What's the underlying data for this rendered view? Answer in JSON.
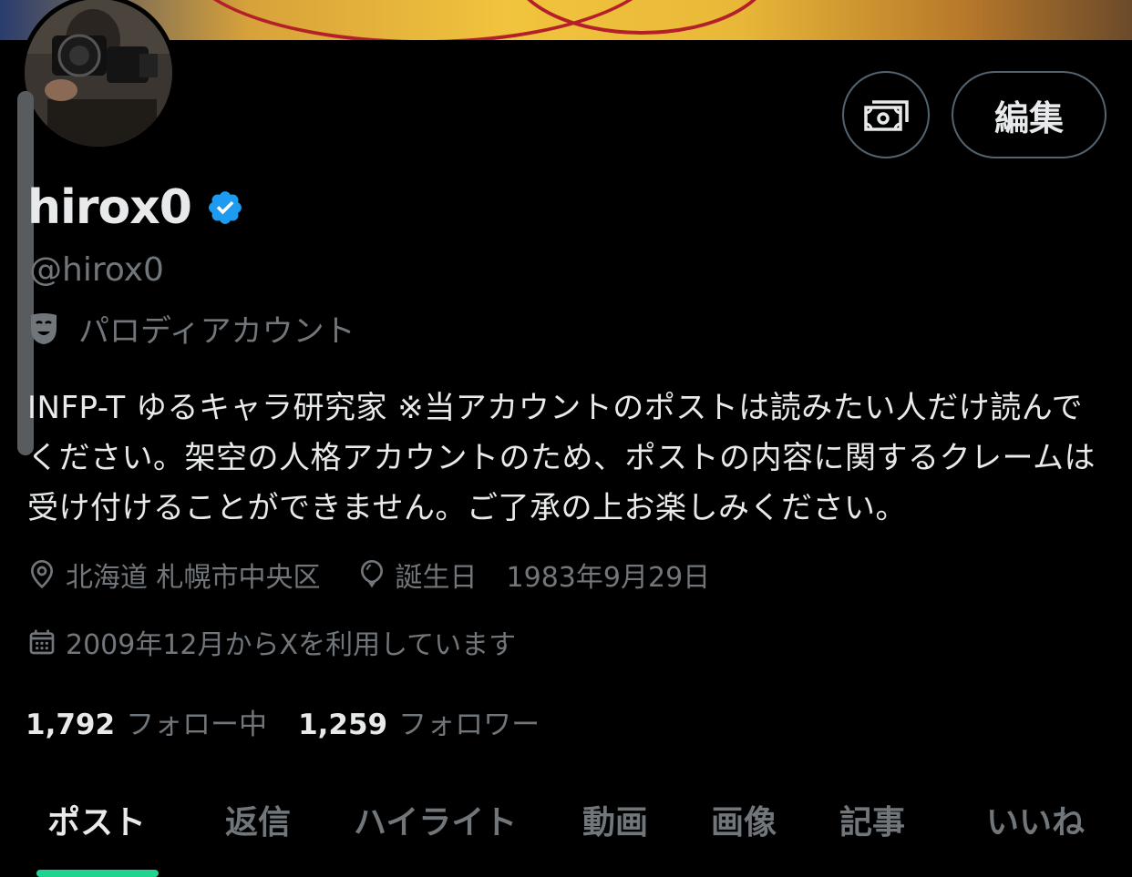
{
  "header": {
    "edit_label": "編集"
  },
  "profile": {
    "display_name": "hirox0",
    "handle": "@hirox0",
    "parody_label": "パロディアカウント",
    "bio": "INFP-T ゆるキャラ研究家 ※当アカウントのポストは読みたい人だけ読んでください。架空の人格アカウントのため、ポストの内容に関するクレームは受け付けることができません。ご了承の上お楽しみください。",
    "location": "北海道 札幌市中央区",
    "birthday_label": "誕生日",
    "birthday": "1983年9月29日",
    "joined": "2009年12月からXを利用しています"
  },
  "stats": {
    "following_count": "1,792",
    "following_label": "フォロー中",
    "followers_count": "1,259",
    "followers_label": "フォロワー"
  },
  "tabs": [
    {
      "label": "ポスト"
    },
    {
      "label": "返信"
    },
    {
      "label": "ハイライト"
    },
    {
      "label": "動画"
    },
    {
      "label": "画像"
    },
    {
      "label": "記事"
    },
    {
      "label": "いいね"
    }
  ],
  "colors": {
    "verified": "#1d9bf0",
    "tab_underline": "#1ed48f",
    "secondary_text": "#71767b"
  },
  "icons": [
    "verified-badge-icon",
    "parody-mask-icon",
    "location-pin-icon",
    "birthday-balloon-icon",
    "calendar-icon",
    "money-icon"
  ]
}
